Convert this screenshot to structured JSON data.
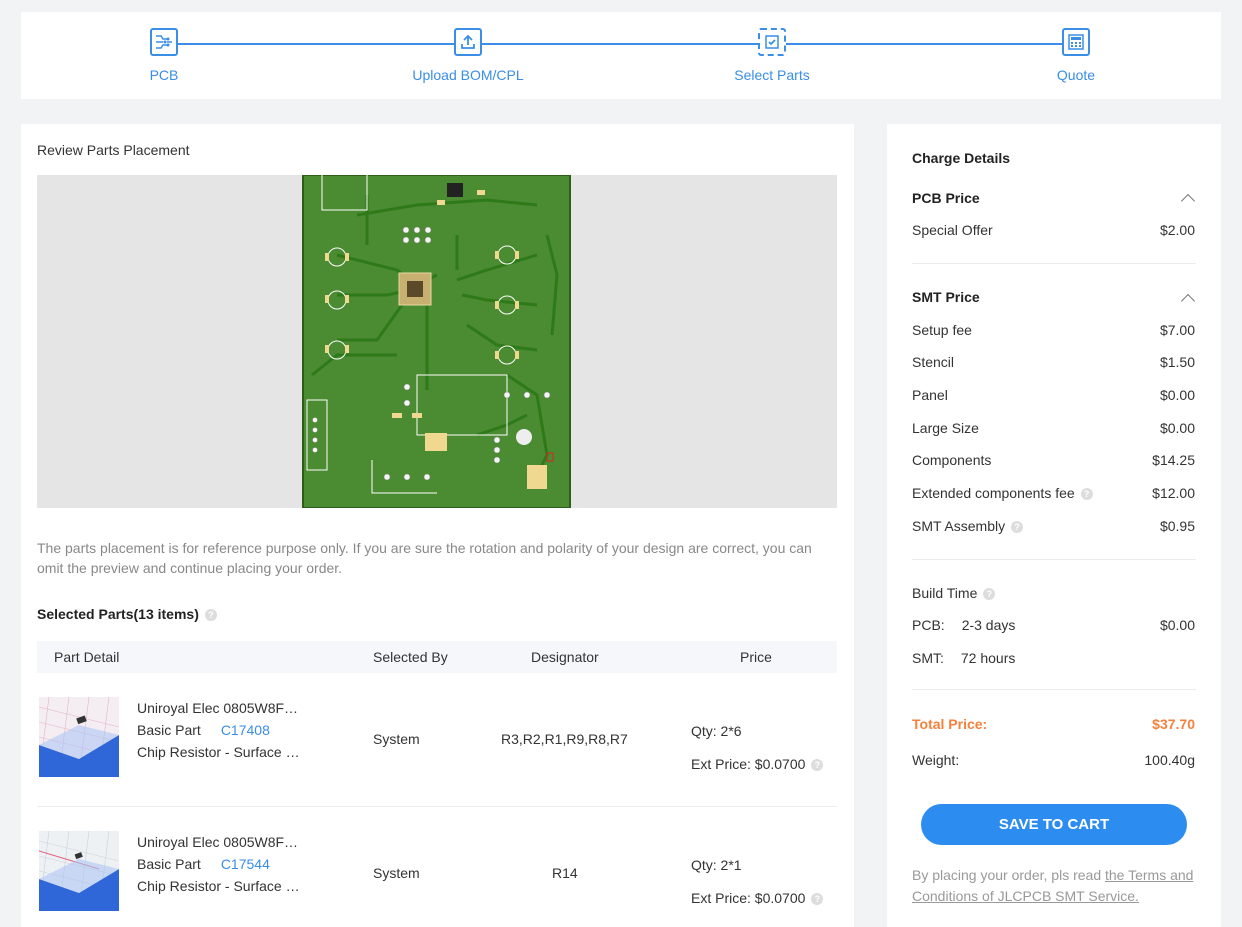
{
  "steps": [
    {
      "label": "PCB",
      "icon": "pcb-icon"
    },
    {
      "label": "Upload BOM/CPL",
      "icon": "upload-icon"
    },
    {
      "label": "Select Parts",
      "icon": "chip-icon"
    },
    {
      "label": "Quote",
      "icon": "calculator-icon"
    }
  ],
  "preview": {
    "title": "Review Parts Placement",
    "note": "The parts placement is for reference purpose only. If you are sure the rotation and polarity of your design are correct, you can omit the preview and continue placing your order."
  },
  "selected": {
    "title": "Selected Parts(13 items)",
    "columns": [
      "Part Detail",
      "Selected By",
      "Designator",
      "Price"
    ],
    "rows": [
      {
        "name": "Uniroyal Elec 0805W8F…",
        "type": "Basic Part",
        "code": "C17408",
        "desc": "Chip Resistor - Surface …",
        "selected_by": "System",
        "designator": "R3,R2,R1,R9,R8,R7",
        "qty": "Qty: 2*6",
        "ext_price": "Ext Price: $0.0700"
      },
      {
        "name": "Uniroyal Elec 0805W8F…",
        "type": "Basic Part",
        "code": "C17544",
        "desc": "Chip Resistor - Surface …",
        "selected_by": "System",
        "designator": "R14",
        "qty": "Qty: 2*1",
        "ext_price": "Ext Price: $0.0700"
      }
    ]
  },
  "charges": {
    "title": "Charge Details",
    "pcb_section": "PCB Price",
    "special_offer": {
      "label": "Special Offer",
      "value": "$2.00"
    },
    "smt_section": "SMT Price",
    "smt_items": [
      {
        "label": "Setup fee",
        "value": "$7.00"
      },
      {
        "label": "Stencil",
        "value": "$1.50"
      },
      {
        "label": "Panel",
        "value": "$0.00"
      },
      {
        "label": "Large Size",
        "value": "$0.00"
      },
      {
        "label": "Components",
        "value": "$14.25"
      },
      {
        "label": "Extended components fee",
        "value": "$12.00"
      },
      {
        "label": "SMT Assembly",
        "value": "$0.95"
      }
    ],
    "build_time": "Build Time",
    "pcb_build": {
      "label": "PCB:",
      "time": "2-3 days",
      "value": "$0.00"
    },
    "smt_build": {
      "label": "SMT:",
      "time": "72 hours"
    },
    "total": {
      "label": "Total Price:",
      "value": "$37.70"
    },
    "weight": {
      "label": "Weight:",
      "value": "100.40g"
    },
    "button": "SAVE TO CART",
    "terms_prefix": "By placing your order, pls read ",
    "terms_link": "the Terms and Conditions of JLCPCB SMT Service."
  },
  "colors": {
    "accent": "#3a8ee6",
    "button": "#2d8cf0",
    "total": "#f5823c",
    "pcb_green": "#4b8b32"
  }
}
